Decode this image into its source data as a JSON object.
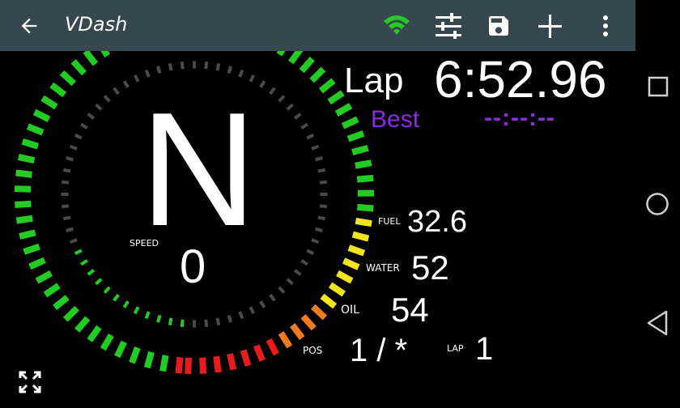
{
  "app": {
    "title": "VDash"
  },
  "toolbar": {
    "icons": [
      "back-arrow-icon",
      "wifi-icon",
      "tune-sliders-icon",
      "save-icon",
      "add-icon",
      "more-vertical-icon"
    ]
  },
  "dash": {
    "gear": "N",
    "speed_label": "SPEED",
    "speed_value": "0",
    "lap_label": "Lap",
    "lap_time": "6:52.96",
    "best_label": "Best",
    "best_time": "--:--:--",
    "fuel_label": "FUEL",
    "fuel_value": "32.6",
    "water_label": "WATER",
    "water_value": "52",
    "oil_label": "OIL",
    "oil_value": "54",
    "pos_label": "POS",
    "pos_value": "1 / *",
    "lap_count_label": "LAP",
    "lap_count_value": "1"
  },
  "colors": {
    "appbar": "#37474f",
    "green": "#22cc22",
    "yellow": "#f2e51c",
    "orange": "#ef7b1e",
    "red": "#e81c1c",
    "best": "#8a2be2",
    "ring_dash": "#4a4a4a"
  },
  "gauge": {
    "rpm_fraction": 0.0,
    "speed_fraction": 0.22
  }
}
